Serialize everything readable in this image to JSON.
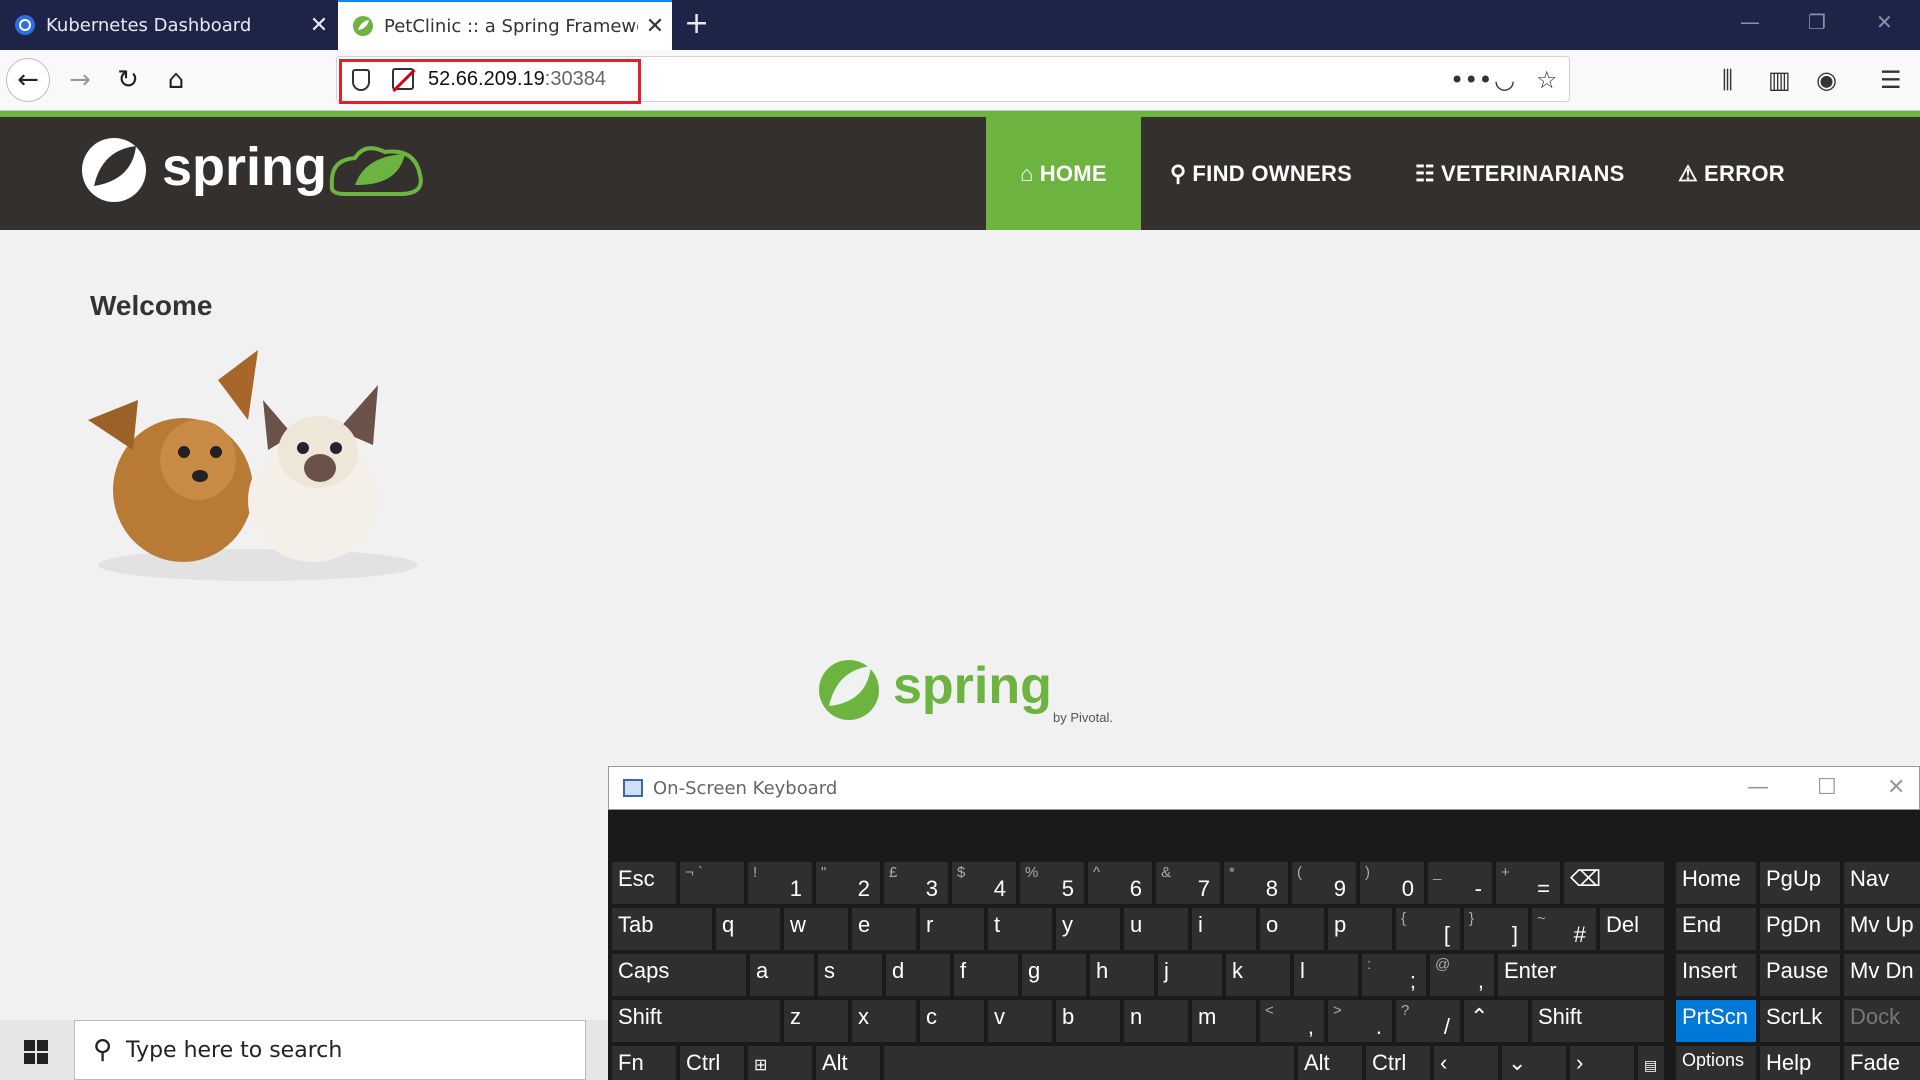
{
  "browser": {
    "tabs": [
      {
        "title": "Kubernetes Dashboard",
        "close": "✕"
      },
      {
        "title": "PetClinic :: a Spring Framework",
        "close": "✕"
      }
    ],
    "new_tab": "+",
    "url_host": "52.66.209.19",
    "url_port": ":30384",
    "accent": "#0a84ff"
  },
  "app": {
    "brand_color": "#6db33f",
    "header_bg": "#34302d",
    "logo_text": "spring",
    "menu": [
      {
        "label": "HOME",
        "icon": "home-icon",
        "active": true
      },
      {
        "label": "FIND OWNERS",
        "icon": "search-icon",
        "active": false
      },
      {
        "label": "VETERINARIANS",
        "icon": "list-icon",
        "active": false
      },
      {
        "label": "ERROR",
        "icon": "warning-icon",
        "active": false
      }
    ],
    "welcome": "Welcome",
    "footer_logo_text": "spring",
    "footer_by": "by Pivotal."
  },
  "osk": {
    "title": "On-Screen Keyboard",
    "keys": {
      "esc": "Esc",
      "tab": "Tab",
      "caps": "Caps",
      "shift": "Shift",
      "shift_r": "Shift",
      "fn": "Fn",
      "ctrl": "Ctrl",
      "alt": "Alt",
      "alt_r": "Alt",
      "ctrl_r": "Ctrl",
      "enter": "Enter",
      "del": "Del",
      "home": "Home",
      "pgup": "PgUp",
      "nav": "Nav",
      "end": "End",
      "pgdn": "PgDn",
      "mvup": "Mv Up",
      "insert": "Insert",
      "pause": "Pause",
      "mvdn": "Mv Dn",
      "prtscn": "PrtScn",
      "scrlk": "ScrLk",
      "dock": "Dock",
      "options": "Options",
      "help": "Help",
      "fade": "Fade",
      "num": [
        [
          "¬ `",
          ""
        ],
        [
          "!",
          "1"
        ],
        [
          "\"",
          "2"
        ],
        [
          "£",
          "3"
        ],
        [
          "$",
          "4"
        ],
        [
          "%",
          "5"
        ],
        [
          "^",
          "6"
        ],
        [
          "&",
          "7"
        ],
        [
          "*",
          "8"
        ],
        [
          "(",
          "9"
        ],
        [
          ")",
          "0"
        ],
        [
          "_",
          "-"
        ],
        [
          "+",
          "="
        ]
      ],
      "q": "q",
      "w": "w",
      "e": "e",
      "r": "r",
      "t": "t",
      "y": "y",
      "u": "u",
      "i": "i",
      "o": "o",
      "p": "p",
      "lb": [
        "{",
        "["
      ],
      "rb": [
        "}",
        "]"
      ],
      "hash": [
        "~",
        "#"
      ],
      "a": "a",
      "s": "s",
      "d": "d",
      "f": "f",
      "g": "g",
      "h": "h",
      "j": "j",
      "k": "k",
      "l": "l",
      "semi": [
        ":",
        ";"
      ],
      "at": [
        "@",
        ","
      ],
      "z": "z",
      "x": "x",
      "c": "c",
      "v": "v",
      "b": "b",
      "n": "n",
      "m": "m",
      "lt": [
        "<",
        ","
      ],
      "gt": [
        ">",
        "."
      ],
      "q_": [
        "?",
        "/"
      ]
    }
  },
  "taskbar": {
    "search_placeholder": "Type here to search"
  }
}
